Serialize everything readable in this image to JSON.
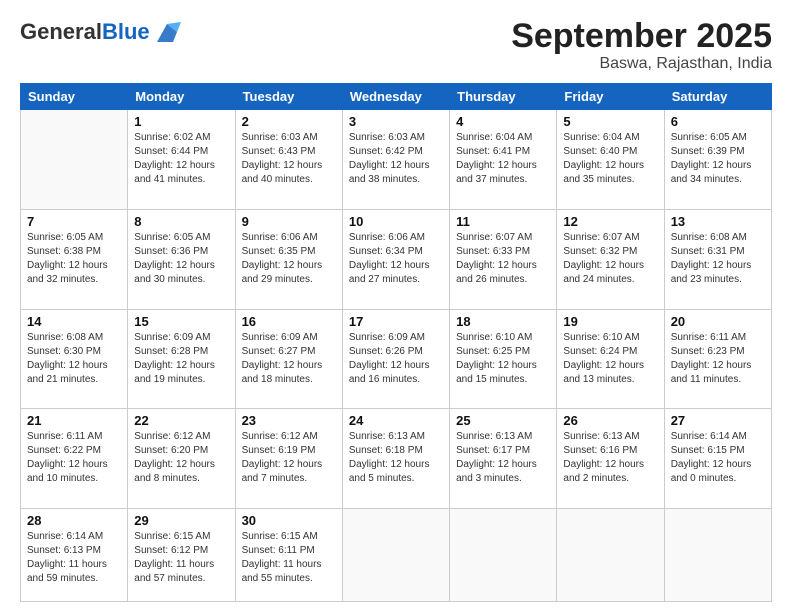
{
  "logo": {
    "general": "General",
    "blue": "Blue"
  },
  "header": {
    "month": "September 2025",
    "location": "Baswa, Rajasthan, India"
  },
  "weekdays": [
    "Sunday",
    "Monday",
    "Tuesday",
    "Wednesday",
    "Thursday",
    "Friday",
    "Saturday"
  ],
  "weeks": [
    [
      {
        "day": "",
        "info": ""
      },
      {
        "day": "1",
        "info": "Sunrise: 6:02 AM\nSunset: 6:44 PM\nDaylight: 12 hours\nand 41 minutes."
      },
      {
        "day": "2",
        "info": "Sunrise: 6:03 AM\nSunset: 6:43 PM\nDaylight: 12 hours\nand 40 minutes."
      },
      {
        "day": "3",
        "info": "Sunrise: 6:03 AM\nSunset: 6:42 PM\nDaylight: 12 hours\nand 38 minutes."
      },
      {
        "day": "4",
        "info": "Sunrise: 6:04 AM\nSunset: 6:41 PM\nDaylight: 12 hours\nand 37 minutes."
      },
      {
        "day": "5",
        "info": "Sunrise: 6:04 AM\nSunset: 6:40 PM\nDaylight: 12 hours\nand 35 minutes."
      },
      {
        "day": "6",
        "info": "Sunrise: 6:05 AM\nSunset: 6:39 PM\nDaylight: 12 hours\nand 34 minutes."
      }
    ],
    [
      {
        "day": "7",
        "info": "Sunrise: 6:05 AM\nSunset: 6:38 PM\nDaylight: 12 hours\nand 32 minutes."
      },
      {
        "day": "8",
        "info": "Sunrise: 6:05 AM\nSunset: 6:36 PM\nDaylight: 12 hours\nand 30 minutes."
      },
      {
        "day": "9",
        "info": "Sunrise: 6:06 AM\nSunset: 6:35 PM\nDaylight: 12 hours\nand 29 minutes."
      },
      {
        "day": "10",
        "info": "Sunrise: 6:06 AM\nSunset: 6:34 PM\nDaylight: 12 hours\nand 27 minutes."
      },
      {
        "day": "11",
        "info": "Sunrise: 6:07 AM\nSunset: 6:33 PM\nDaylight: 12 hours\nand 26 minutes."
      },
      {
        "day": "12",
        "info": "Sunrise: 6:07 AM\nSunset: 6:32 PM\nDaylight: 12 hours\nand 24 minutes."
      },
      {
        "day": "13",
        "info": "Sunrise: 6:08 AM\nSunset: 6:31 PM\nDaylight: 12 hours\nand 23 minutes."
      }
    ],
    [
      {
        "day": "14",
        "info": "Sunrise: 6:08 AM\nSunset: 6:30 PM\nDaylight: 12 hours\nand 21 minutes."
      },
      {
        "day": "15",
        "info": "Sunrise: 6:09 AM\nSunset: 6:28 PM\nDaylight: 12 hours\nand 19 minutes."
      },
      {
        "day": "16",
        "info": "Sunrise: 6:09 AM\nSunset: 6:27 PM\nDaylight: 12 hours\nand 18 minutes."
      },
      {
        "day": "17",
        "info": "Sunrise: 6:09 AM\nSunset: 6:26 PM\nDaylight: 12 hours\nand 16 minutes."
      },
      {
        "day": "18",
        "info": "Sunrise: 6:10 AM\nSunset: 6:25 PM\nDaylight: 12 hours\nand 15 minutes."
      },
      {
        "day": "19",
        "info": "Sunrise: 6:10 AM\nSunset: 6:24 PM\nDaylight: 12 hours\nand 13 minutes."
      },
      {
        "day": "20",
        "info": "Sunrise: 6:11 AM\nSunset: 6:23 PM\nDaylight: 12 hours\nand 11 minutes."
      }
    ],
    [
      {
        "day": "21",
        "info": "Sunrise: 6:11 AM\nSunset: 6:22 PM\nDaylight: 12 hours\nand 10 minutes."
      },
      {
        "day": "22",
        "info": "Sunrise: 6:12 AM\nSunset: 6:20 PM\nDaylight: 12 hours\nand 8 minutes."
      },
      {
        "day": "23",
        "info": "Sunrise: 6:12 AM\nSunset: 6:19 PM\nDaylight: 12 hours\nand 7 minutes."
      },
      {
        "day": "24",
        "info": "Sunrise: 6:13 AM\nSunset: 6:18 PM\nDaylight: 12 hours\nand 5 minutes."
      },
      {
        "day": "25",
        "info": "Sunrise: 6:13 AM\nSunset: 6:17 PM\nDaylight: 12 hours\nand 3 minutes."
      },
      {
        "day": "26",
        "info": "Sunrise: 6:13 AM\nSunset: 6:16 PM\nDaylight: 12 hours\nand 2 minutes."
      },
      {
        "day": "27",
        "info": "Sunrise: 6:14 AM\nSunset: 6:15 PM\nDaylight: 12 hours\nand 0 minutes."
      }
    ],
    [
      {
        "day": "28",
        "info": "Sunrise: 6:14 AM\nSunset: 6:13 PM\nDaylight: 11 hours\nand 59 minutes."
      },
      {
        "day": "29",
        "info": "Sunrise: 6:15 AM\nSunset: 6:12 PM\nDaylight: 11 hours\nand 57 minutes."
      },
      {
        "day": "30",
        "info": "Sunrise: 6:15 AM\nSunset: 6:11 PM\nDaylight: 11 hours\nand 55 minutes."
      },
      {
        "day": "",
        "info": ""
      },
      {
        "day": "",
        "info": ""
      },
      {
        "day": "",
        "info": ""
      },
      {
        "day": "",
        "info": ""
      }
    ]
  ]
}
